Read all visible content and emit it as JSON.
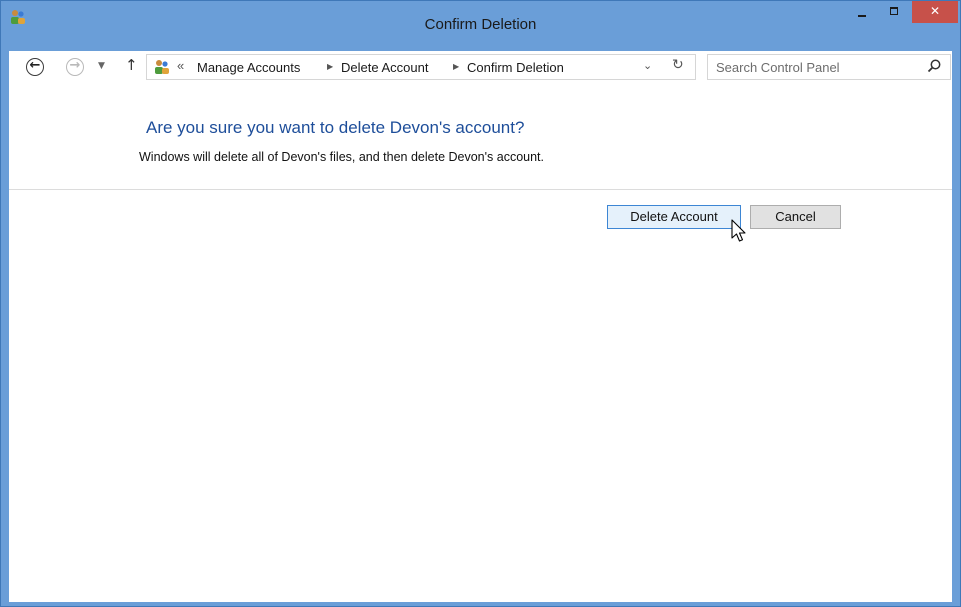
{
  "window": {
    "title": "Confirm Deletion",
    "buttons": {
      "minimize": "minimize",
      "maximize": "maximize",
      "close": "close"
    }
  },
  "nav": {
    "back_icon": "back-arrow-icon",
    "forward_icon": "forward-arrow-icon",
    "recent_icon": "chevron-down-icon",
    "up_icon": "up-arrow-icon"
  },
  "address": {
    "overflow": "«",
    "crumbs": [
      "Manage Accounts",
      "Delete Account",
      "Confirm Deletion"
    ],
    "separator": "▶",
    "dropdown": "⌄",
    "refresh": "↻"
  },
  "search": {
    "placeholder": "Search Control Panel",
    "value": ""
  },
  "content": {
    "heading": "Are you sure you want to delete Devon's account?",
    "description": "Windows will delete all of Devon's files, and then delete Devon's account."
  },
  "actions": {
    "delete_label": "Delete Account",
    "cancel_label": "Cancel"
  },
  "colors": {
    "window_frame": "#6a9ed8",
    "close_button": "#c7514a",
    "heading": "#1e4e9a",
    "primary_button_bg": "#e5f1fb",
    "primary_button_border": "#3d86d4"
  }
}
